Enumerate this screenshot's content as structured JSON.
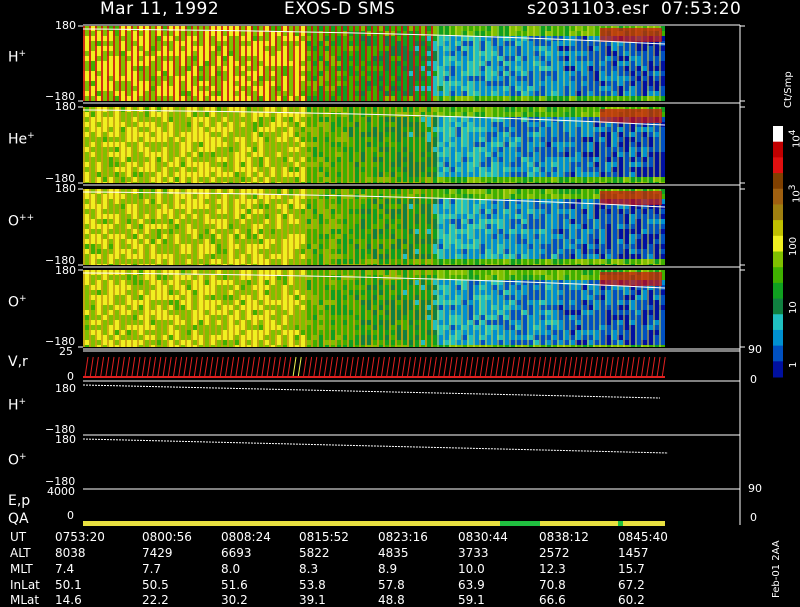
{
  "header": {
    "date": "Mar 11, 1992",
    "instrument": "EXOS-D SMS",
    "file": "s2031103.esr",
    "time": "07:53:20"
  },
  "panels": [
    {
      "label": "H",
      "sup": "+",
      "ymax": "180",
      "ymin": "−180"
    },
    {
      "label": "He",
      "sup": "+",
      "ymax": "180",
      "ymin": "−180"
    },
    {
      "label": "O",
      "sup": "++",
      "ymax": "180",
      "ymin": "−180"
    },
    {
      "label": "O",
      "sup": "+",
      "ymax": "180",
      "ymin": "−180"
    }
  ],
  "vr_panel": {
    "label": "V,r",
    "ymax": "25",
    "ymin": "0",
    "right_max": "90",
    "right_min": "0"
  },
  "line_panels": [
    {
      "label": "H",
      "sup": "+",
      "ymax": "180",
      "ymin": "−180"
    },
    {
      "label": "O",
      "sup": "+",
      "ymax": "180",
      "ymin": "−180"
    }
  ],
  "ep_panel": {
    "label": "E,p",
    "ymax": "4000",
    "ymin": "0",
    "right_max": "90",
    "right_min": "0"
  },
  "qa_label": "QA",
  "colorbar": {
    "unit": "Ct/Smp",
    "ticks": [
      {
        "label": "10",
        "sup": "4"
      },
      {
        "label": "10",
        "sup": "3"
      },
      {
        "label": "100",
        "sup": ""
      },
      {
        "label": "10",
        "sup": ""
      },
      {
        "label": "1",
        "sup": ""
      }
    ],
    "colors": [
      "#ffffff",
      "#c00000",
      "#e01010",
      "#804000",
      "#a06010",
      "#a08010",
      "#c0c000",
      "#f0f020",
      "#80c000",
      "#40b000",
      "#10a020",
      "#108040",
      "#20c0c0",
      "#0090d0",
      "#0050c0",
      "#0010a0"
    ]
  },
  "footer": {
    "rows": [
      {
        "name": "UT",
        "values": [
          "0753:20",
          "0800:56",
          "0808:24",
          "0815:52",
          "0823:16",
          "0830:44",
          "0838:12",
          "0845:40"
        ]
      },
      {
        "name": "ALT",
        "values": [
          "8038",
          "7429",
          "6693",
          "5822",
          "4835",
          "3733",
          "2572",
          "1457"
        ]
      },
      {
        "name": "MLT",
        "values": [
          "7.4",
          "7.7",
          "8.0",
          "8.3",
          "8.9",
          "10.0",
          "12.3",
          "15.7"
        ]
      },
      {
        "name": "InLat",
        "values": [
          "50.1",
          "50.5",
          "51.6",
          "53.8",
          "57.8",
          "63.9",
          "70.8",
          "67.2"
        ]
      },
      {
        "name": "MLat",
        "values": [
          "14.6",
          "22.2",
          "30.2",
          "39.1",
          "48.8",
          "59.1",
          "66.6",
          "60.2"
        ]
      }
    ],
    "side_note": "Feb-01 2AA"
  },
  "chart_data": {
    "type": "heatmap",
    "title": "Mar 11, 1992   EXOS-D SMS",
    "x_label": "UT",
    "x_ticks": [
      "0753:20",
      "0800:56",
      "0808:24",
      "0815:52",
      "0823:16",
      "0830:44",
      "0838:12",
      "0845:40"
    ],
    "y_range": [
      -180,
      180
    ],
    "species": [
      "H+",
      "He+",
      "O++",
      "O+"
    ],
    "color_scale": {
      "unit": "Ct/Smp",
      "log": true,
      "range": [
        1,
        10000
      ]
    }
  }
}
